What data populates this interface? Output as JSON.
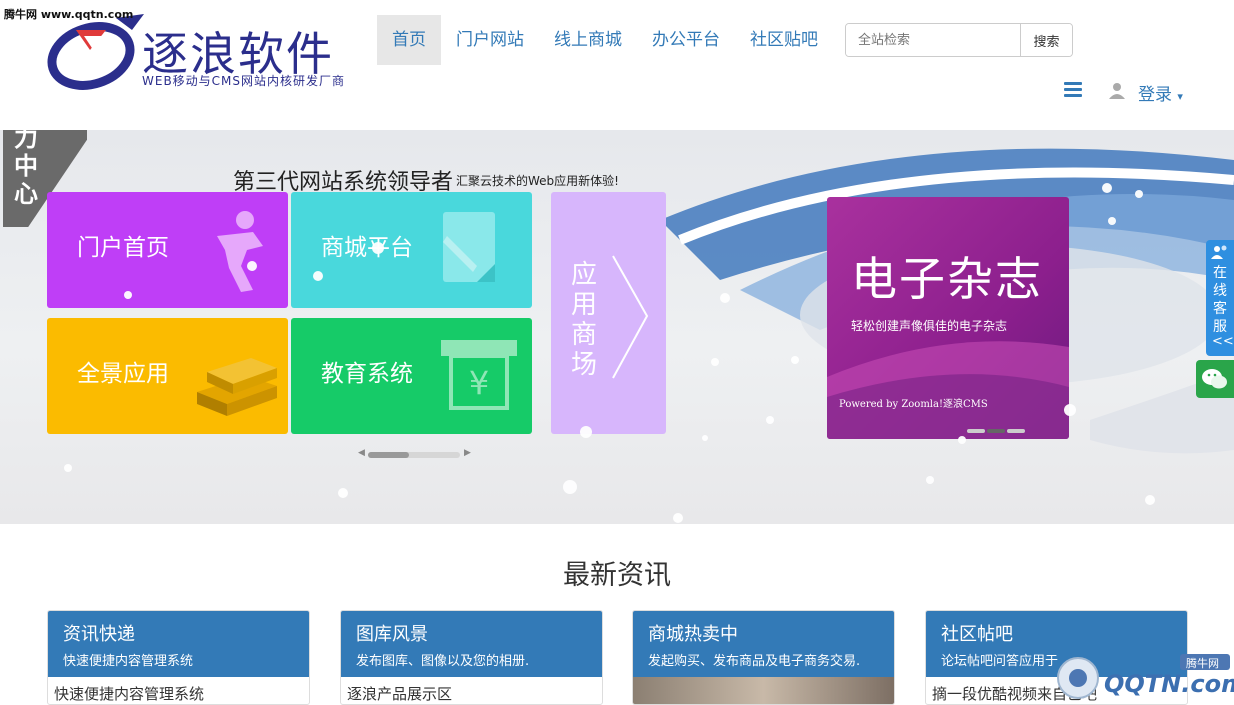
{
  "watermark": {
    "top_text": "腾牛网 www.qqtn.com",
    "badge": "腾牛网",
    "logo_text": "QQTN.com"
  },
  "header": {
    "logo_title": "逐浪软件",
    "logo_subtitle": "WEB移动与CMS网站内核研发厂商",
    "nav": [
      {
        "label": "首页",
        "active": true
      },
      {
        "label": "门户网站"
      },
      {
        "label": "线上商城"
      },
      {
        "label": "办公平台"
      },
      {
        "label": "社区贴吧"
      }
    ],
    "search": {
      "placeholder": "全站检索",
      "button": "搜索"
    },
    "login_label": "登录"
  },
  "banner": {
    "side_label": "力中心",
    "title": "第三代网站系统领导者",
    "subtitle": "汇聚云技术的Web应用新体验!",
    "tiles": {
      "portal": "门户首页",
      "mall": "商城平台",
      "pano": "全景应用",
      "edu": "教育系统",
      "app_store": "应用商场"
    },
    "magazine": {
      "title": "电子杂志",
      "subtitle": "轻松创建声像俱佳的电子杂志",
      "powered": "Powered by Zoomla!逐浪CMS"
    },
    "scroll_progress": 0.45
  },
  "float": {
    "service": "在线客服",
    "collapse": "<<"
  },
  "news": {
    "title": "最新资讯",
    "cards": [
      {
        "title": "资讯快递",
        "desc": "快速便捷内容管理系统",
        "first": "快速便捷内容管理系统"
      },
      {
        "title": "图库风景",
        "desc": "发布图库、图像以及您的相册.",
        "first": "逐浪产品展示区"
      },
      {
        "title": "商城热卖中",
        "desc": "发起购买、发布商品及电子商务交易.",
        "first": ""
      },
      {
        "title": "社区帖吧",
        "desc": "论坛帖吧问答应用于",
        "first": "摘一段优酷视频来自己吧"
      }
    ]
  },
  "colors": {
    "nav_blue": "#337ab7",
    "card_head": "#337ab7",
    "portal": "#bf3ef7",
    "mall": "#49d8dc",
    "pano": "#fbbb00",
    "edu": "#16cb68",
    "app": "#d7b6fc",
    "magazine": "#a9319e"
  }
}
